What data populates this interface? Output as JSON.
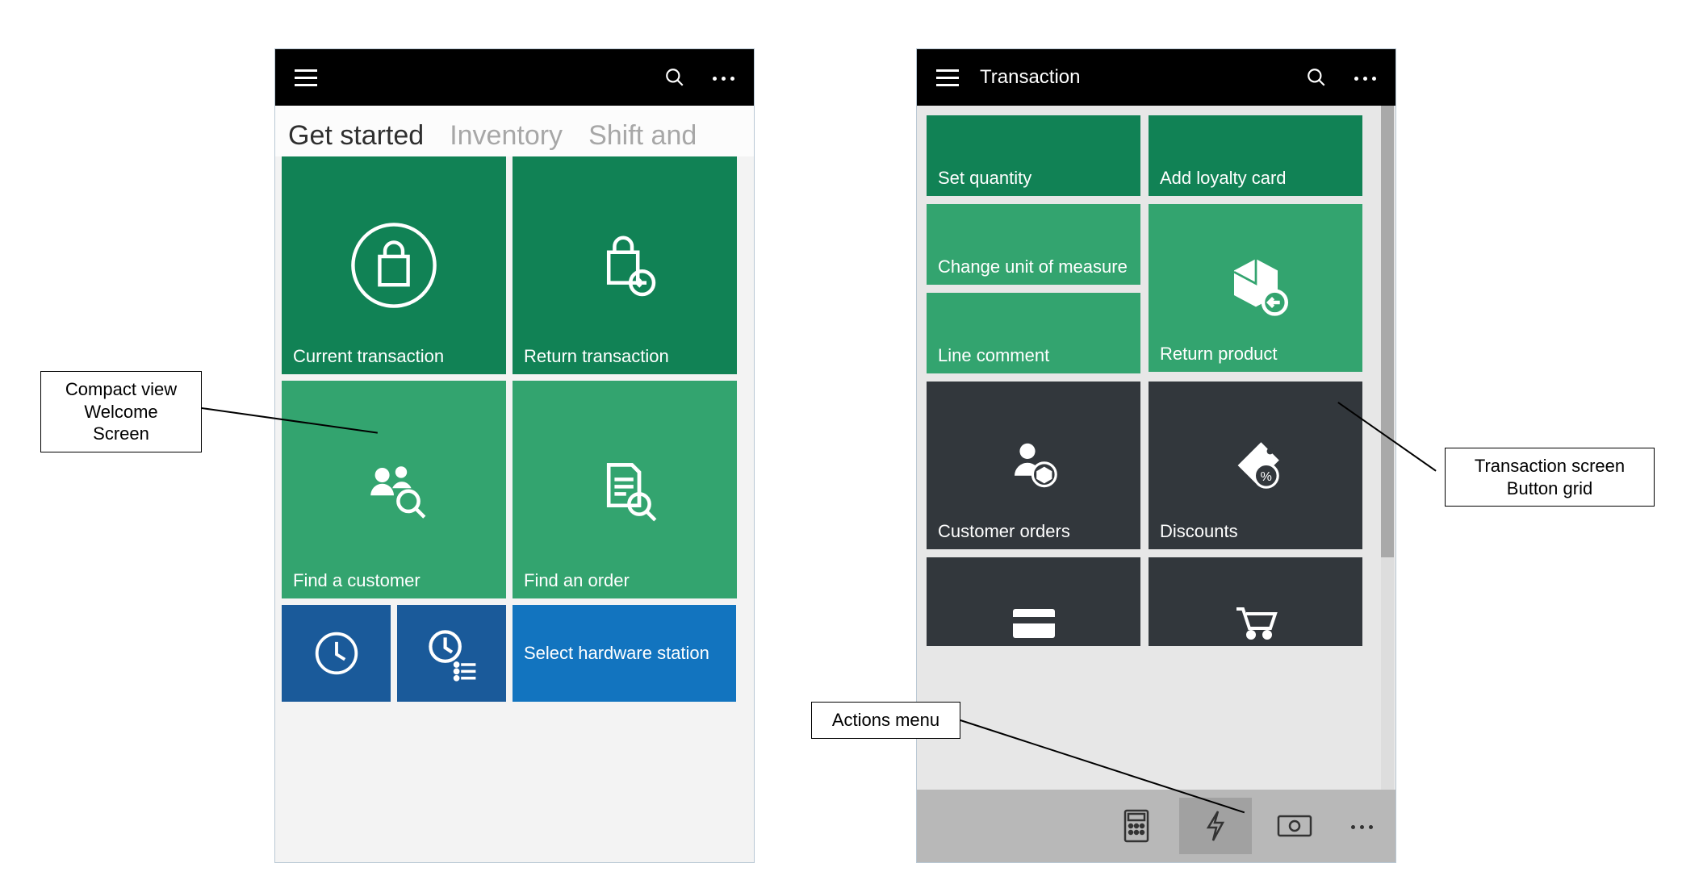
{
  "annotations": {
    "compact_view": "Compact view\nWelcome\nScreen",
    "actions_menu": "Actions menu",
    "button_grid": "Transaction screen\nButton grid"
  },
  "left_phone": {
    "appbar": {
      "title": ""
    },
    "tabs": [
      {
        "label": "Get started",
        "active": true
      },
      {
        "label": "Inventory",
        "active": false
      },
      {
        "label": "Shift and",
        "active": false
      }
    ],
    "tiles": {
      "current_transaction": "Current transaction",
      "return_transaction": "Return transaction",
      "find_customer": "Find a customer",
      "find_order": "Find an order",
      "select_hardware": "Select hardware station"
    }
  },
  "right_phone": {
    "appbar": {
      "title": "Transaction"
    },
    "tiles": {
      "set_quantity": "Set quantity",
      "add_loyalty": "Add loyalty card",
      "change_uom": "Change unit of measure",
      "line_comment": "Line comment",
      "return_product": "Return product",
      "customer_orders": "Customer orders",
      "discounts": "Discounts"
    }
  }
}
